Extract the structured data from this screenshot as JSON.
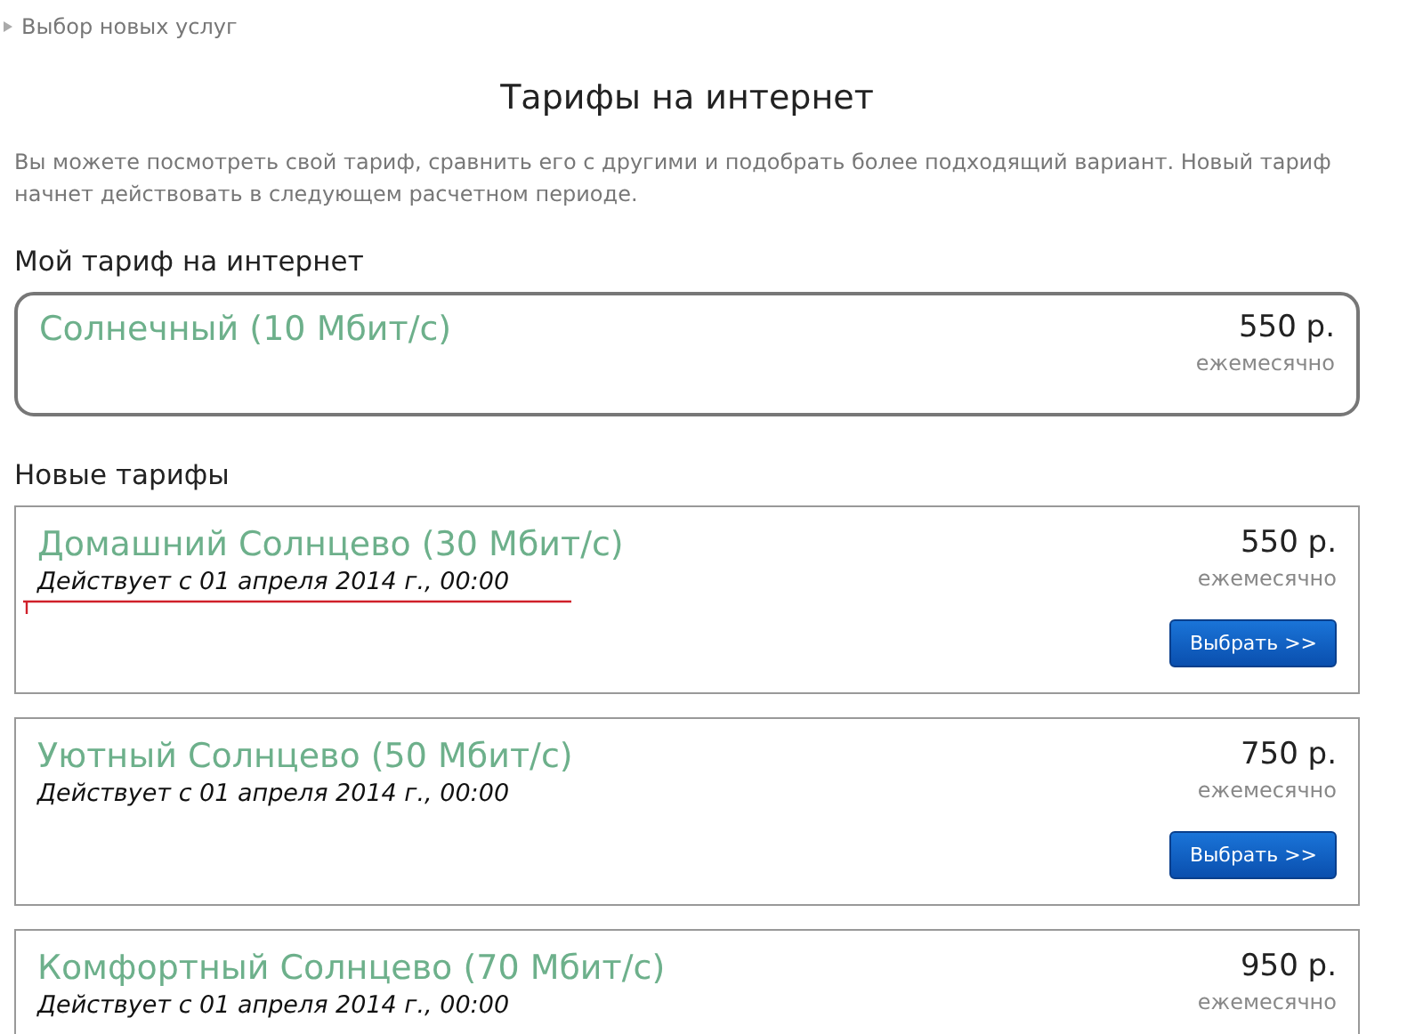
{
  "breadcrumb": {
    "label": "Выбор новых услуг"
  },
  "title": "Тарифы на интернет",
  "description": "Вы можете посмотреть свой тариф, сравнить его с другими и подобрать более подходящий вариант. Новый тариф начнет действовать в следующем расчетном периоде.",
  "current_section": {
    "heading": "Мой тариф на интернет",
    "plan": {
      "name": "Солнечный (10 Мбит/с)",
      "price": "550 р.",
      "period": "ежемесячно"
    }
  },
  "new_section": {
    "heading": "Новые тарифы",
    "plans": [
      {
        "name": "Домашний Солнцево (30 Мбит/с)",
        "valid_from": "Действует с 01 апреля 2014 г., 00:00",
        "price": "550 р.",
        "period": "ежемесячно",
        "button": "Выбрать >>",
        "underlined": true
      },
      {
        "name": "Уютный Солнцево (50 Мбит/с)",
        "valid_from": "Действует с 01 апреля 2014 г., 00:00",
        "price": "750 р.",
        "period": "ежемесячно",
        "button": "Выбрать >>",
        "underlined": false
      },
      {
        "name": "Комфортный Солнцево (70 Мбит/с)",
        "valid_from": "Действует с 01 апреля 2014 г., 00:00",
        "price": "950 р.",
        "period": "ежемесячно",
        "underlined": false
      }
    ]
  }
}
